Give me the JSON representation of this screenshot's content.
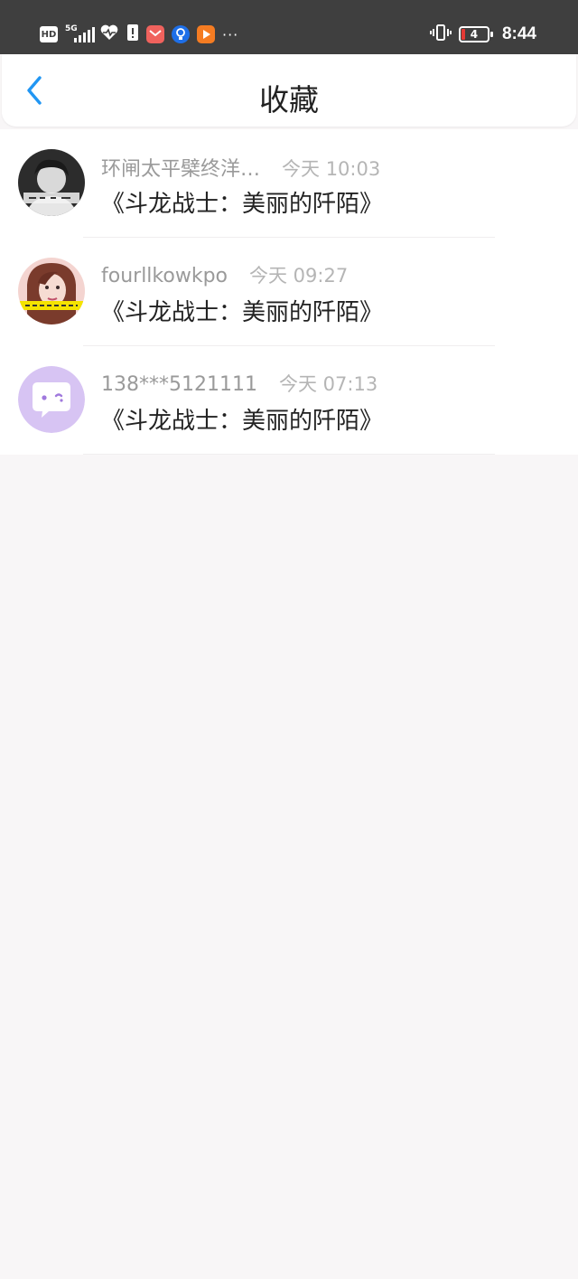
{
  "status_bar": {
    "hd_label": "HD",
    "network_label": "5G",
    "more": "···",
    "battery_level": "4",
    "time": "8:44"
  },
  "header": {
    "back_icon": "chevron-left-icon",
    "title": "收藏"
  },
  "favorites": [
    {
      "username": "环闸太平檗终洋…",
      "time": "今天 10:03",
      "title": "《斗龙战士：美丽的阡陌》",
      "avatar": "photo-avatar-dark"
    },
    {
      "username": "fourllkowkpo",
      "time": "今天 09:27",
      "title": "《斗龙战士：美丽的阡陌》",
      "avatar": "photo-avatar-woman"
    },
    {
      "username": "138***5121111",
      "time": "今天 07:13",
      "title": "《斗龙战士：美丽的阡陌》",
      "avatar": "chat-bubble-avatar"
    }
  ],
  "colors": {
    "accent": "#2196f3",
    "status_bar_bg": "#3f3f3f",
    "avatar_purple": "#d7c4f3"
  }
}
